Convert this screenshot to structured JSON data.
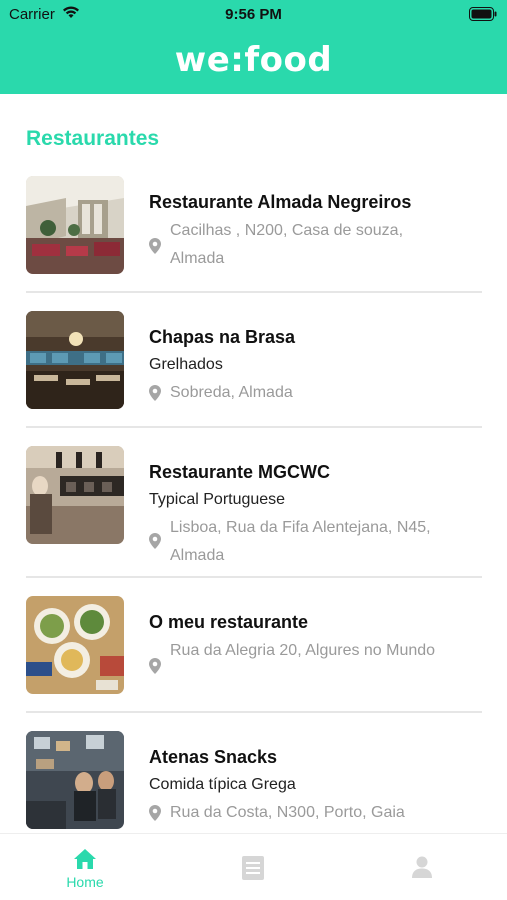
{
  "status_bar": {
    "carrier": "Carrier",
    "time": "9:56 PM"
  },
  "header": {
    "logo": "we:food"
  },
  "section": {
    "title": "Restaurantes"
  },
  "restaurants": [
    {
      "name": "Restaurante Almada Negreiros",
      "category": "",
      "address_line1": "Cacilhas , N200, Casa de souza,",
      "address_line2": "Almada"
    },
    {
      "name": "Chapas na Brasa",
      "category": "Grelhados",
      "address_line1": "Sobreda, Almada",
      "address_line2": ""
    },
    {
      "name": "Restaurante MGCWC",
      "category": "Typical Portuguese",
      "address_line1": "Lisboa, Rua da Fifa Alentejana, N45,",
      "address_line2": "Almada"
    },
    {
      "name": "O meu restaurante",
      "category": "",
      "address_line1": "Rua da Alegria 20, Algures no Mundo",
      "address_line2": ""
    },
    {
      "name": "Atenas Snacks",
      "category": "Comida típica Grega",
      "address_line1": "Rua da Costa, N300, Porto, Gaia",
      "address_line2": ""
    }
  ],
  "tabbar": {
    "home_label": "Home"
  },
  "colors": {
    "accent": "#2ad9ac",
    "muted_text": "#9a9a9a",
    "inactive_icon": "#d6d6d6"
  }
}
